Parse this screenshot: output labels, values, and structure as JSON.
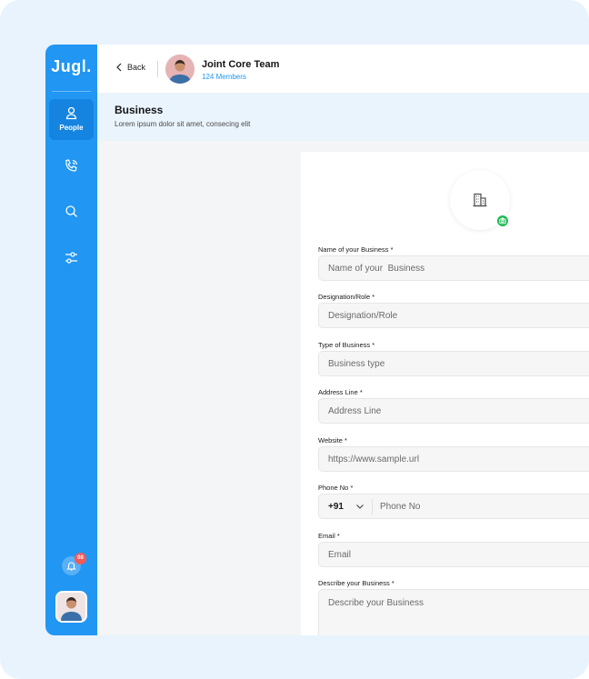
{
  "sidebar": {
    "logo": "Jugl.",
    "active_item_label": "People",
    "items": [
      "people-icon",
      "phone-icon",
      "search-icon",
      "sliders-icon"
    ],
    "notification_count": "08",
    "accent": "#2196f3"
  },
  "header": {
    "back_label": "Back",
    "team_name": "Joint Core Team",
    "team_members": "124 Members"
  },
  "section": {
    "title": "Business",
    "subtitle": "Lorem ipsum dolor sit amet, consecing elit"
  },
  "form": {
    "upload_icon": "building-icon",
    "camera_icon": "camera-icon",
    "business_name": {
      "label": "Name of your  Business *",
      "placeholder": "Name of your  Business"
    },
    "designation": {
      "label": "Designation/Role *",
      "placeholder": "Designation/Role"
    },
    "business_type": {
      "label": "Type of Business *",
      "placeholder": "Business type"
    },
    "address": {
      "label": "Address Line *",
      "placeholder": "Address Line"
    },
    "website": {
      "label": "Website *",
      "placeholder": "https://www.sample.url"
    },
    "phone": {
      "label": "Phone No *",
      "country_code": "+91",
      "placeholder": "Phone No"
    },
    "email": {
      "label": "Email *",
      "placeholder": "Email"
    },
    "description": {
      "label": "Describe your Business *",
      "placeholder": "Describe your Business"
    }
  }
}
